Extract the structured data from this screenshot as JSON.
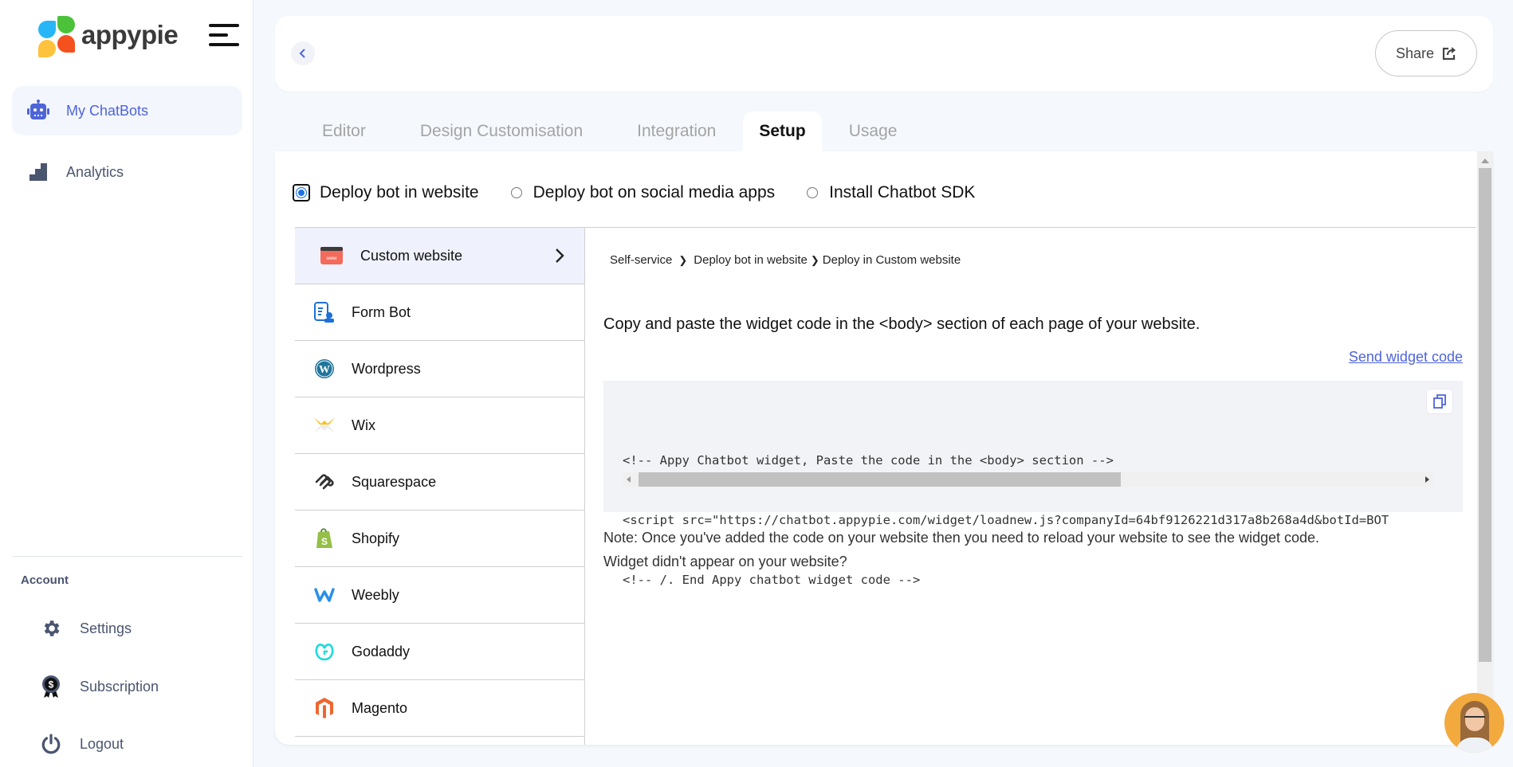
{
  "app": {
    "brand": "appypie"
  },
  "sidebar": {
    "items": [
      {
        "label": "My ChatBots",
        "icon": "robot-icon",
        "active": true
      },
      {
        "label": "Analytics",
        "icon": "analytics-icon",
        "active": false
      }
    ],
    "account_heading": "Account",
    "account_items": [
      {
        "label": "Settings",
        "icon": "gear-icon"
      },
      {
        "label": "Subscription",
        "icon": "subscription-badge-icon"
      },
      {
        "label": "Logout",
        "icon": "power-icon"
      }
    ]
  },
  "topbar": {
    "share_label": "Share"
  },
  "tabs": [
    {
      "label": "Editor",
      "active": false
    },
    {
      "label": "Design Customisation",
      "active": false
    },
    {
      "label": "Integration",
      "active": false
    },
    {
      "label": "Setup",
      "active": true
    },
    {
      "label": "Usage",
      "active": false
    }
  ],
  "deploy_options": [
    {
      "label": "Deploy bot in website",
      "checked": true
    },
    {
      "label": "Deploy bot on social media apps",
      "checked": false
    },
    {
      "label": "Install Chatbot SDK",
      "checked": false
    }
  ],
  "platforms": [
    {
      "label": "Custom website",
      "icon": "www-browser-icon",
      "active": true
    },
    {
      "label": "Form Bot",
      "icon": "form-bot-icon",
      "active": false
    },
    {
      "label": "Wordpress",
      "icon": "wordpress-icon",
      "active": false
    },
    {
      "label": "Wix",
      "icon": "wix-icon",
      "active": false
    },
    {
      "label": "Squarespace",
      "icon": "squarespace-icon",
      "active": false
    },
    {
      "label": "Shopify",
      "icon": "shopify-icon",
      "active": false
    },
    {
      "label": "Weebly",
      "icon": "weebly-icon",
      "active": false
    },
    {
      "label": "Godaddy",
      "icon": "godaddy-icon",
      "active": false
    },
    {
      "label": "Magento",
      "icon": "magento-icon",
      "active": false
    }
  ],
  "panel": {
    "breadcrumb": [
      "Self-service",
      "Deploy bot in website",
      "Deploy in Custom website"
    ],
    "headline": "Copy and paste the widget code in the <body> section of each page of your website.",
    "send_link": "Send widget code",
    "code_lines": [
      "<!-- Appy Chatbot widget, Paste the code in the <body> section -->",
      "<script src=\"https://chatbot.appypie.com/widget/loadnew.js?companyId=64bf9126221d317a8b268a4d&botId=BOT",
      "<!-- /. End Appy chatbot widget code -->"
    ],
    "note_line1": "Note: Once you've added the code on your website then you need to reload your website to see the widget code.",
    "note_line2": "Widget didn't appear on your website?"
  },
  "colors": {
    "accent": "#4e64d9",
    "background": "#f5f8fd",
    "chat_avatar_bg": "#f2aa3f"
  }
}
